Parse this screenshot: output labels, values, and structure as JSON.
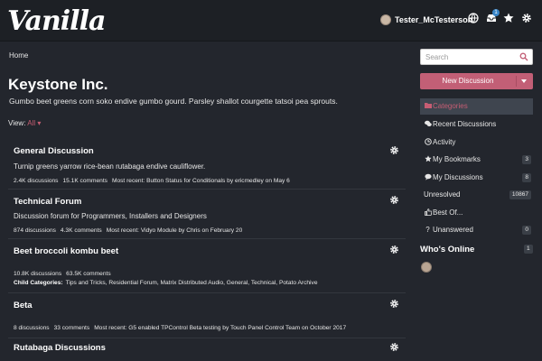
{
  "header": {
    "logo": "Vanilla",
    "username": "Tester_McTesterson",
    "notifications_count": "1",
    "icons": [
      "globe-icon",
      "inbox-icon",
      "star-icon",
      "gear-icon"
    ]
  },
  "breadcrumb": "Home",
  "page": {
    "title": "Keystone Inc.",
    "description": "Gumbo beet greens corn soko endive gumbo gourd. Parsley shallot courgette tatsoi pea sprouts.",
    "view_label": "View:",
    "view_value": "All"
  },
  "categories": [
    {
      "title": "General Discussion",
      "description": "Turnip greens yarrow rice-bean rutabaga endive cauliflower.",
      "discussions": "2.4K discussions",
      "comments": "15.1K comments",
      "recent": "Most recent: Button Status for Conditionals by ericmedley on May 6"
    },
    {
      "title": "Technical Forum",
      "description": "Discussion forum for Programmers, Installers and Designers",
      "discussions": "874 discussions",
      "comments": "4.3K comments",
      "recent": "Most recent: Vidyo Module by Chris on February 20"
    },
    {
      "title": "Beet broccoli kombu beet",
      "description": "",
      "discussions": "10.8K discussions",
      "comments": "63.5K comments",
      "child_label": "Child Categories:",
      "child_list": "Tips and Tricks, Residential Forum, Matrix Distributed Audio, General, Technical, Potato Archive"
    },
    {
      "title": "Beta",
      "description": "",
      "discussions": "8 discussions",
      "comments": "33 comments",
      "recent": "Most recent: G5 enabled TPControl Beta testing by Touch Panel Control Team on October 2017"
    },
    {
      "title": "Rutabaga Discussions",
      "description": ""
    }
  ],
  "sidebar": {
    "search_placeholder": "Search",
    "new_discussion": "New Discussion",
    "items": [
      {
        "label": "Categories",
        "icon": "folder-icon",
        "count": ""
      },
      {
        "label": "Recent Discussions",
        "icon": "chat-bubbles-icon",
        "count": ""
      },
      {
        "label": "Activity",
        "icon": "clock-icon",
        "count": ""
      },
      {
        "label": "My Bookmarks",
        "icon": "star-icon",
        "count": "3"
      },
      {
        "label": "My Discussions",
        "icon": "chat-bubble-icon",
        "count": "8"
      },
      {
        "label": "Unresolved",
        "icon": "",
        "count": "10867"
      },
      {
        "label": "Best Of...",
        "icon": "thumbs-up-icon",
        "count": ""
      },
      {
        "label": "Unanswered",
        "icon": "question-icon",
        "count": "0"
      }
    ],
    "whos_online": "Who's Online",
    "whos_online_count": "1"
  },
  "colors": {
    "accent": "#c25f76",
    "background": "#23262d",
    "header": "#1d2025"
  }
}
